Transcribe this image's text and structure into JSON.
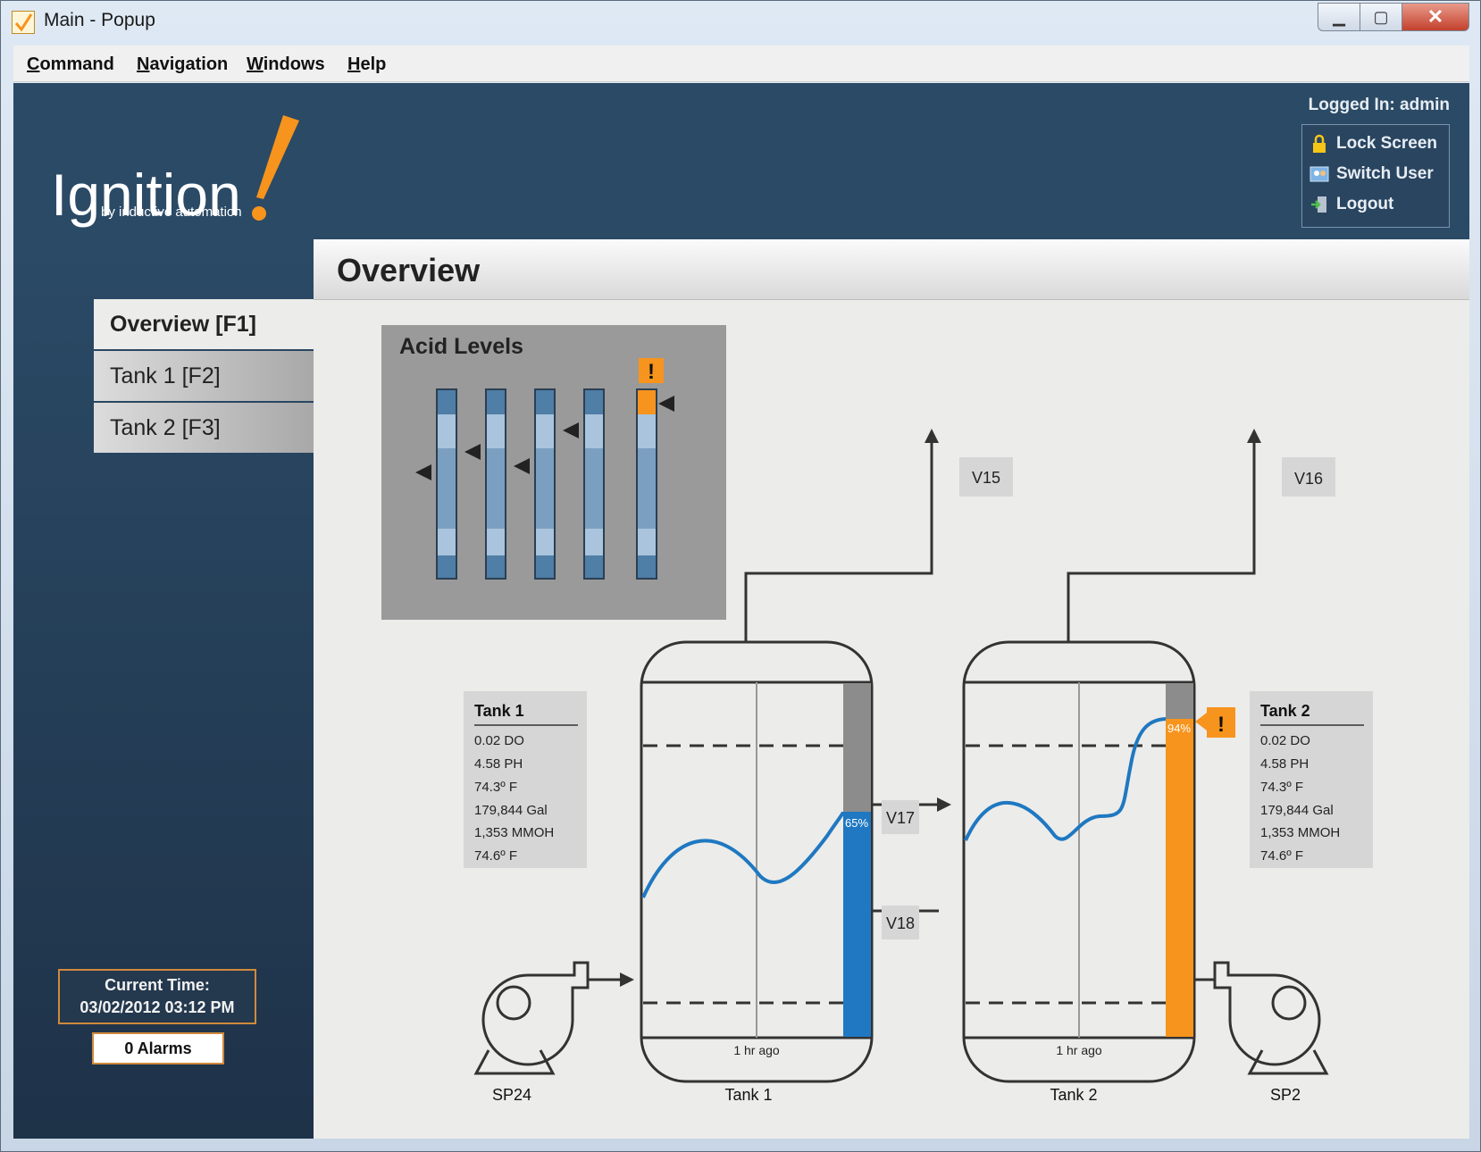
{
  "window": {
    "title": "Main - Popup"
  },
  "menu": [
    "Command",
    "Navigation",
    "Windows",
    "Help"
  ],
  "header": {
    "logo_name": "Ignition",
    "logo_tagline": "by inductive automation",
    "logged_in": "Logged In: admin",
    "user_actions": {
      "lock": "Lock Screen",
      "switch": "Switch User",
      "logout": "Logout"
    }
  },
  "nav": {
    "overview": "Overview [F1]",
    "tank1": "Tank 1 [F2]",
    "tank2": "Tank 2 [F3]"
  },
  "page_title": "Overview",
  "status": {
    "time_label": "Current Time:",
    "time_value": "03/02/2012 03:12 PM",
    "alarms": "0 Alarms"
  },
  "acid": {
    "title": "Acid Levels",
    "alert": "!"
  },
  "valves": {
    "v15": "V15",
    "v16": "V16",
    "v17": "V17",
    "v18": "V18"
  },
  "tank1": {
    "title": "Tank 1",
    "readings": [
      "0.02 DO",
      "4.58 PH",
      "74.3º F",
      "179,844 Gal",
      "1,353 MMOH",
      "74.6º F"
    ],
    "level_label": "65%",
    "level": 0.65,
    "time_label": "1 hr ago",
    "name": "Tank 1"
  },
  "tank2": {
    "title": "Tank 2",
    "readings": [
      "0.02 DO",
      "4.58 PH",
      "74.3º F",
      "179,844 Gal",
      "1,353 MMOH",
      "74.6º F"
    ],
    "level_label": "94%",
    "level": 0.94,
    "alert": "!",
    "time_label": "1 hr ago",
    "name": "Tank 2"
  },
  "pumps": {
    "left": "SP24",
    "right": "SP2"
  },
  "colors": {
    "accent_orange": "#f7941d",
    "trend_blue": "#1f78c1",
    "panel_dark": "#2b4a66"
  }
}
